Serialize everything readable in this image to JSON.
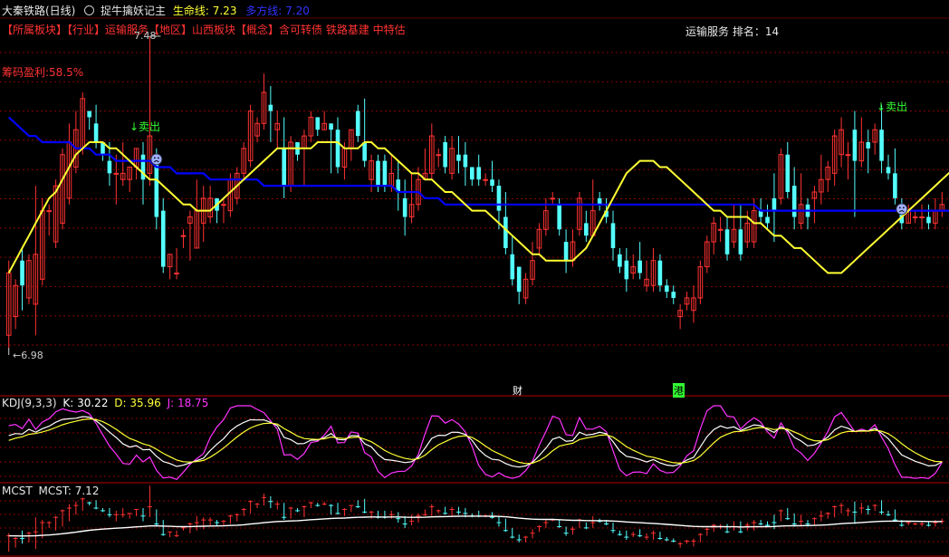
{
  "header": {
    "stock_title": "大秦铁路(日线)",
    "indicator_icon": "circle-icon",
    "indicator_name": "捉牛擒妖记主",
    "life_line_label": "生命线: 7.23",
    "long_short_label": "多方线: 7.20"
  },
  "info": {
    "tags_line": "【所属板块】【行业】运输服务【地区】山西板块【概念】含可转债 铁路基建 中特估",
    "rank_line": "运输服务 排名：14",
    "profit_ratio": "筹码盈利:58.5%",
    "max_label": "7.48",
    "min_label": "←6.98",
    "sell_label_1": "↓卖出",
    "sell_label_2": "↓卖出",
    "event_cai": "财",
    "event_gang": "港"
  },
  "kdj": {
    "title": "KDJ(9,3,3)",
    "k_label": "K: 30.22",
    "d_label": "D: 35.96",
    "j_label": "J: 18.75"
  },
  "mcst": {
    "title": "MCST",
    "value_label": "MCST: 7.12"
  },
  "colors": {
    "up": "#ff3232",
    "down": "#54ffff",
    "grid": "#8b0000",
    "yellow_line": "#ffff33",
    "blue_line": "#0000ff",
    "k_line": "#ffffff",
    "d_line": "#ffff33",
    "j_line": "#ff33ff",
    "sell": "#33ff33"
  },
  "chart_data": {
    "type": "candlestick",
    "price_range": [
      6.98,
      7.48
    ],
    "bars": [
      [
        7.0,
        7.1,
        7.12,
        6.98
      ],
      [
        7.03,
        7.08,
        7.09,
        7.01
      ],
      [
        7.12,
        7.08,
        7.14,
        7.04
      ],
      [
        7.06,
        7.12,
        7.13,
        7.05
      ],
      [
        7.05,
        7.13,
        7.24,
        7.0
      ],
      [
        7.09,
        7.2,
        7.22,
        7.08
      ],
      [
        7.2,
        7.2,
        7.21,
        7.16
      ],
      [
        7.15,
        7.24,
        7.25,
        7.14
      ],
      [
        7.18,
        7.29,
        7.3,
        7.17
      ],
      [
        7.22,
        7.31,
        7.34,
        7.21
      ],
      [
        7.27,
        7.33,
        7.36,
        7.26
      ],
      [
        7.3,
        7.38,
        7.39,
        7.29
      ],
      [
        7.36,
        7.35,
        7.36,
        7.33
      ],
      [
        7.34,
        7.31,
        7.37,
        7.3
      ],
      [
        7.31,
        7.29,
        7.31,
        7.28
      ],
      [
        7.28,
        7.26,
        7.31,
        7.24
      ],
      [
        7.26,
        7.26,
        7.29,
        7.21
      ],
      [
        7.25,
        7.26,
        7.31,
        7.24
      ],
      [
        7.25,
        7.27,
        7.27,
        7.23
      ],
      [
        7.27,
        7.3,
        7.3,
        7.25
      ],
      [
        7.29,
        7.25,
        7.31,
        7.21
      ],
      [
        7.26,
        7.32,
        7.48,
        7.24
      ],
      [
        7.28,
        7.19,
        7.3,
        7.17
      ],
      [
        7.2,
        7.11,
        7.22,
        7.1
      ],
      [
        7.11,
        7.13,
        7.13,
        7.09
      ],
      [
        7.1,
        7.1,
        7.14,
        7.09
      ],
      [
        7.16,
        7.16,
        7.17,
        7.14
      ],
      [
        7.18,
        7.19,
        7.2,
        7.12
      ],
      [
        7.14,
        7.2,
        7.25,
        7.14
      ],
      [
        7.18,
        7.22,
        7.24,
        7.15
      ],
      [
        7.19,
        7.22,
        7.24,
        7.18
      ],
      [
        7.22,
        7.2,
        7.22,
        7.18
      ],
      [
        7.21,
        7.21,
        7.22,
        7.18
      ],
      [
        7.2,
        7.25,
        7.26,
        7.19
      ],
      [
        7.22,
        7.26,
        7.27,
        7.21
      ],
      [
        7.26,
        7.3,
        7.31,
        7.25
      ],
      [
        7.28,
        7.36,
        7.37,
        7.27
      ],
      [
        7.32,
        7.34,
        7.35,
        7.31
      ],
      [
        7.34,
        7.39,
        7.42,
        7.33
      ],
      [
        7.37,
        7.36,
        7.4,
        7.31
      ],
      [
        7.33,
        7.34,
        7.36,
        7.3
      ],
      [
        7.3,
        7.24,
        7.35,
        7.22
      ],
      [
        7.24,
        7.31,
        7.32,
        7.23
      ],
      [
        7.31,
        7.29,
        7.31,
        7.28
      ],
      [
        7.3,
        7.32,
        7.33,
        7.24
      ],
      [
        7.32,
        7.35,
        7.36,
        7.31
      ],
      [
        7.35,
        7.33,
        7.35,
        7.32
      ],
      [
        7.33,
        7.34,
        7.36,
        7.33
      ],
      [
        7.34,
        7.33,
        7.34,
        7.26
      ],
      [
        7.33,
        7.27,
        7.35,
        7.26
      ],
      [
        7.27,
        7.3,
        7.31,
        7.25
      ],
      [
        7.3,
        7.33,
        7.33,
        7.28
      ],
      [
        7.36,
        7.32,
        7.37,
        7.31
      ],
      [
        7.31,
        7.28,
        7.38,
        7.27
      ],
      [
        7.25,
        7.28,
        7.29,
        7.23
      ],
      [
        7.28,
        7.24,
        7.29,
        7.23
      ],
      [
        7.28,
        7.24,
        7.29,
        7.23
      ],
      [
        7.24,
        7.26,
        7.29,
        7.23
      ],
      [
        7.25,
        7.23,
        7.28,
        7.2
      ],
      [
        7.22,
        7.19,
        7.25,
        7.16
      ],
      [
        7.19,
        7.21,
        7.26,
        7.18
      ],
      [
        7.21,
        7.25,
        7.27,
        7.2
      ],
      [
        7.25,
        7.26,
        7.3,
        7.25
      ],
      [
        7.26,
        7.32,
        7.34,
        7.25
      ],
      [
        7.29,
        7.29,
        7.3,
        7.27
      ],
      [
        7.31,
        7.27,
        7.32,
        7.26
      ],
      [
        7.26,
        7.3,
        7.32,
        7.25
      ],
      [
        7.29,
        7.28,
        7.32,
        7.26
      ],
      [
        7.29,
        7.27,
        7.31,
        7.24
      ],
      [
        7.27,
        7.25,
        7.27,
        7.24
      ],
      [
        7.27,
        7.25,
        7.29,
        7.24
      ],
      [
        7.25,
        7.25,
        7.26,
        7.24
      ],
      [
        7.25,
        7.24,
        7.28,
        7.23
      ],
      [
        7.24,
        7.2,
        7.25,
        7.17
      ],
      [
        7.19,
        7.14,
        7.23,
        7.13
      ],
      [
        7.13,
        7.09,
        7.16,
        7.08
      ],
      [
        7.11,
        7.07,
        7.11,
        7.05
      ],
      [
        7.06,
        7.09,
        7.1,
        7.05
      ],
      [
        7.09,
        7.12,
        7.15,
        7.08
      ],
      [
        7.14,
        7.17,
        7.18,
        7.13
      ],
      [
        7.17,
        7.2,
        7.22,
        7.16
      ],
      [
        7.22,
        7.22,
        7.23,
        7.21
      ],
      [
        7.21,
        7.17,
        7.22,
        7.16
      ],
      [
        7.15,
        7.12,
        7.17,
        7.1
      ],
      [
        7.12,
        7.15,
        7.17,
        7.11
      ],
      [
        7.17,
        7.22,
        7.23,
        7.16
      ],
      [
        7.18,
        7.16,
        7.2,
        7.15
      ],
      [
        7.16,
        7.2,
        7.25,
        7.16
      ],
      [
        7.22,
        7.21,
        7.23,
        7.2
      ],
      [
        7.2,
        7.19,
        7.22,
        7.18
      ],
      [
        7.18,
        7.14,
        7.2,
        7.12
      ],
      [
        7.13,
        7.11,
        7.14,
        7.1
      ],
      [
        7.12,
        7.09,
        7.14,
        7.07
      ],
      [
        7.1,
        7.11,
        7.13,
        7.09
      ],
      [
        7.12,
        7.1,
        7.15,
        7.09
      ],
      [
        7.08,
        7.09,
        7.12,
        7.07
      ],
      [
        7.08,
        7.12,
        7.14,
        7.07
      ],
      [
        7.12,
        7.08,
        7.13,
        7.07
      ],
      [
        7.08,
        7.07,
        7.09,
        7.06
      ],
      [
        7.07,
        7.06,
        7.08,
        7.05
      ],
      [
        7.03,
        7.04,
        7.05,
        7.01
      ],
      [
        7.05,
        7.06,
        7.07,
        7.04
      ],
      [
        7.04,
        7.06,
        7.08,
        7.02
      ],
      [
        7.06,
        7.11,
        7.12,
        7.05
      ],
      [
        7.11,
        7.15,
        7.16,
        7.1
      ],
      [
        7.15,
        7.18,
        7.19,
        7.13
      ],
      [
        7.17,
        7.17,
        7.19,
        7.15
      ],
      [
        7.17,
        7.13,
        7.19,
        7.12
      ],
      [
        7.15,
        7.17,
        7.21,
        7.14
      ],
      [
        7.17,
        7.13,
        7.21,
        7.12
      ],
      [
        7.15,
        7.18,
        7.2,
        7.14
      ],
      [
        7.15,
        7.2,
        7.22,
        7.14
      ],
      [
        7.2,
        7.19,
        7.22,
        7.18
      ],
      [
        7.19,
        7.18,
        7.21,
        7.17
      ],
      [
        7.22,
        7.2,
        7.26,
        7.15
      ],
      [
        7.22,
        7.29,
        7.3,
        7.21
      ],
      [
        7.29,
        7.23,
        7.31,
        7.22
      ],
      [
        7.24,
        7.19,
        7.27,
        7.17
      ],
      [
        7.18,
        7.21,
        7.26,
        7.17
      ],
      [
        7.21,
        7.19,
        7.22,
        7.17
      ],
      [
        7.22,
        7.23,
        7.24,
        7.18
      ],
      [
        7.23,
        7.25,
        7.29,
        7.21
      ],
      [
        7.25,
        7.27,
        7.28,
        7.23
      ],
      [
        7.26,
        7.32,
        7.33,
        7.24
      ],
      [
        7.29,
        7.33,
        7.35,
        7.27
      ],
      [
        7.29,
        7.29,
        7.31,
        7.25
      ],
      [
        7.33,
        7.28,
        7.36,
        7.19
      ],
      [
        7.28,
        7.31,
        7.35,
        7.27
      ],
      [
        7.31,
        7.3,
        7.33,
        7.26
      ],
      [
        7.31,
        7.33,
        7.34,
        7.29
      ],
      [
        7.33,
        7.28,
        7.37,
        7.26
      ],
      [
        7.27,
        7.26,
        7.29,
        7.25
      ],
      [
        7.26,
        7.22,
        7.3,
        7.21
      ],
      [
        7.21,
        7.18,
        7.22,
        7.17
      ],
      [
        7.18,
        7.2,
        7.21,
        7.18
      ],
      [
        7.19,
        7.19,
        7.2,
        7.18
      ],
      [
        7.19,
        7.19,
        7.21,
        7.17
      ],
      [
        7.19,
        7.18,
        7.21,
        7.17
      ],
      [
        7.18,
        7.2,
        7.22,
        7.17
      ],
      [
        7.2,
        7.21,
        7.23,
        7.19
      ]
    ],
    "life_line": [
      7.1,
      7.12,
      7.14,
      7.16,
      7.18,
      7.2,
      7.22,
      7.23,
      7.25,
      7.27,
      7.29,
      7.3,
      7.31,
      7.31,
      7.31,
      7.3,
      7.3,
      7.29,
      7.28,
      7.27,
      7.26,
      7.25,
      7.25,
      7.24,
      7.23,
      7.22,
      7.21,
      7.21,
      7.2,
      7.2,
      7.2,
      7.21,
      7.22,
      7.23,
      7.24,
      7.25,
      7.26,
      7.27,
      7.28,
      7.29,
      7.3,
      7.3,
      7.3,
      7.3,
      7.3,
      7.3,
      7.31,
      7.31,
      7.31,
      7.31,
      7.3,
      7.3,
      7.3,
      7.31,
      7.31,
      7.3,
      7.3,
      7.29,
      7.28,
      7.27,
      7.26,
      7.26,
      7.25,
      7.25,
      7.24,
      7.23,
      7.23,
      7.22,
      7.21,
      7.2,
      7.2,
      7.2,
      7.19,
      7.18,
      7.17,
      7.16,
      7.15,
      7.14,
      7.13,
      7.13,
      7.12,
      7.12,
      7.12,
      7.12,
      7.12,
      7.13,
      7.14,
      7.16,
      7.18,
      7.2,
      7.22,
      7.24,
      7.26,
      7.27,
      7.28,
      7.28,
      7.28,
      7.27,
      7.27,
      7.26,
      7.25,
      7.24,
      7.23,
      7.22,
      7.21,
      7.2,
      7.2,
      7.19,
      7.19,
      7.19,
      7.19,
      7.18,
      7.18,
      7.17,
      7.16,
      7.16,
      7.15,
      7.14,
      7.14,
      7.13,
      7.12,
      7.11,
      7.1,
      7.1,
      7.1,
      7.11,
      7.12,
      7.13,
      7.14,
      7.15,
      7.16,
      7.17,
      7.18,
      7.19,
      7.2,
      7.21,
      7.22,
      7.23,
      7.24,
      7.25,
      7.26,
      7.27,
      7.27,
      7.28,
      7.28,
      7.28,
      7.27,
      7.27,
      7.26,
      7.25,
      7.24,
      7.23,
      7.22,
      7.21,
      7.2
    ],
    "long_short_line": [
      7.35,
      7.34,
      7.33,
      7.32,
      7.32,
      7.31,
      7.31,
      7.31,
      7.31,
      7.31,
      7.3,
      7.3,
      7.3,
      7.29,
      7.29,
      7.29,
      7.28,
      7.28,
      7.28,
      7.28,
      7.28,
      7.28,
      7.27,
      7.27,
      7.27,
      7.26,
      7.26,
      7.26,
      7.26,
      7.26,
      7.25,
      7.25,
      7.25,
      7.25,
      7.25,
      7.25,
      7.25,
      7.25,
      7.24,
      7.24,
      7.24,
      7.24,
      7.24,
      7.24,
      7.24,
      7.24,
      7.24,
      7.24,
      7.24,
      7.24,
      7.24,
      7.24,
      7.24,
      7.24,
      7.24,
      7.24,
      7.24,
      7.24,
      7.23,
      7.23,
      7.23,
      7.23,
      7.22,
      7.22,
      7.22,
      7.21,
      7.21,
      7.21,
      7.21,
      7.21,
      7.21,
      7.21,
      7.21,
      7.21,
      7.21,
      7.21,
      7.21,
      7.21,
      7.21,
      7.21,
      7.21,
      7.21,
      7.21,
      7.21,
      7.21,
      7.21,
      7.21,
      7.21,
      7.21,
      7.21,
      7.21,
      7.21,
      7.21,
      7.21,
      7.21,
      7.21,
      7.21,
      7.21,
      7.21,
      7.21,
      7.21,
      7.21,
      7.21,
      7.21,
      7.21,
      7.21,
      7.21,
      7.21,
      7.21,
      7.21,
      7.21,
      7.21,
      7.2,
      7.2,
      7.2,
      7.2,
      7.2,
      7.2,
      7.2,
      7.2,
      7.2,
      7.2,
      7.2,
      7.2,
      7.2,
      7.2,
      7.2,
      7.2,
      7.2,
      7.2,
      7.2,
      7.2,
      7.2,
      7.2,
      7.2,
      7.2,
      7.2,
      7.2,
      7.2,
      7.2,
      7.2,
      7.2,
      7.2,
      7.2,
      7.2,
      7.2,
      7.2,
      7.2,
      7.2,
      7.2,
      7.2
    ]
  }
}
